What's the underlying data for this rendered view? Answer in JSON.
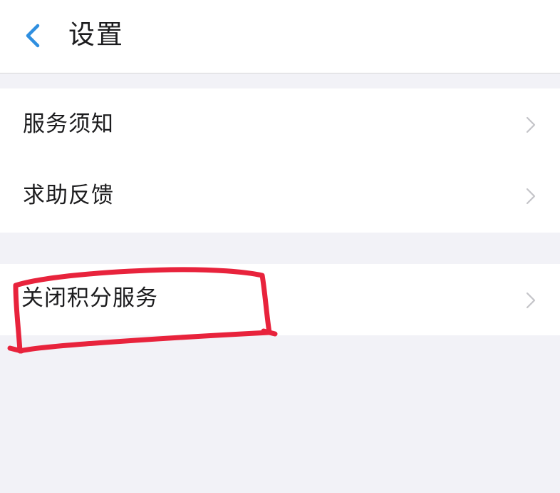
{
  "header": {
    "title": "设置",
    "back_icon": "chevron-left-icon",
    "accent_color": "#2f8fe0"
  },
  "groups": [
    {
      "items": [
        {
          "label": "服务须知",
          "icon": "chevron-right-icon"
        },
        {
          "label": "求助反馈",
          "icon": "chevron-right-icon"
        }
      ]
    },
    {
      "items": [
        {
          "label": "关闭积分服务",
          "icon": "chevron-right-icon"
        }
      ]
    }
  ],
  "annotation": {
    "shape": "hand-drawn rectangle",
    "color": "#e8233c",
    "target": "关闭积分服务"
  }
}
